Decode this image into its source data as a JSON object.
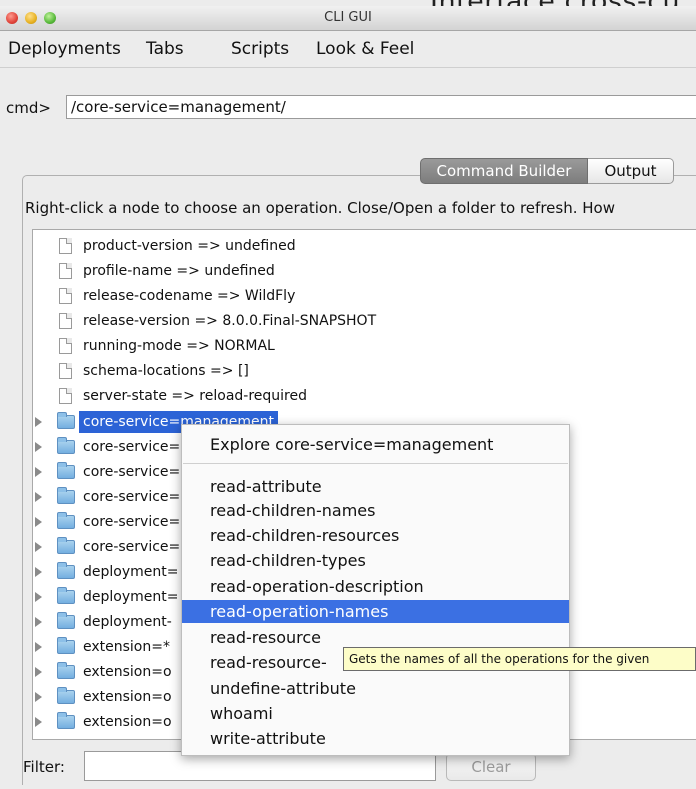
{
  "top_clipped_text": "Interface cross-cu",
  "window": {
    "title": "CLI GUI"
  },
  "menu": [
    "Deployments",
    "Tabs",
    "Scripts",
    "Look & Feel"
  ],
  "cmd": {
    "label": "cmd>",
    "value": "/core-service=management/"
  },
  "tabs": {
    "builder": "Command Builder",
    "output": "Output"
  },
  "hint": "Right-click a node to choose an operation.  Close/Open a folder to refresh.  How",
  "tree": {
    "leaf_items": [
      "product-version => undefined",
      "profile-name => undefined",
      "release-codename => WildFly",
      "release-version => 8.0.0.Final-SNAPSHOT",
      "running-mode => NORMAL",
      "schema-locations => []",
      "server-state => reload-required"
    ],
    "selected_folder": "core-service=management",
    "folders": [
      "core-service=",
      "core-service=",
      "core-service=",
      "core-service=",
      "core-service=",
      "deployment=",
      "deployment=",
      "deployment-",
      "extension=*",
      "extension=o",
      "extension=o",
      "extension=o"
    ]
  },
  "popup": {
    "header": "Explore core-service=management",
    "items": [
      "read-attribute",
      "read-children-names",
      "read-children-resources",
      "read-children-types",
      "read-operation-description",
      "read-operation-names",
      "read-resource",
      "read-resource-",
      "undefine-attribute",
      "whoami",
      "write-attribute"
    ],
    "highlighted_index": 5
  },
  "tooltip": "Gets the names of all the operations for the given",
  "filter": {
    "label": "Filter:",
    "value": "",
    "clear_label": "Clear"
  }
}
